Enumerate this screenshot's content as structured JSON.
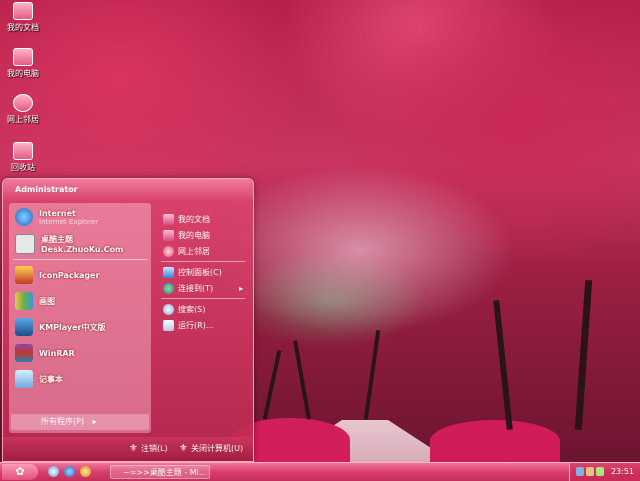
{
  "desktop_icons": [
    {
      "name": "mydocs",
      "label": "我的文档"
    },
    {
      "name": "mycomputer",
      "label": "我的电脑"
    },
    {
      "name": "network",
      "label": "网上邻居"
    },
    {
      "name": "recycle",
      "label": "回收站"
    }
  ],
  "start_menu": {
    "user": "Administrator",
    "pinned": [
      {
        "title": "Internet",
        "subtitle": "Internet Explorer"
      },
      {
        "title": "桌酷主题Desk.ZhuoKu.Com"
      }
    ],
    "programs": [
      {
        "title": "IconPackager"
      },
      {
        "title": "画图"
      },
      {
        "title": "KMPlayer中文版"
      },
      {
        "title": "WinRAR"
      },
      {
        "title": "记事本"
      }
    ],
    "all_programs": "所有程序(P)",
    "all_programs_arrow": "▸",
    "right": [
      {
        "label": "我的文档"
      },
      {
        "label": "我的电脑"
      },
      {
        "label": "网上邻居"
      },
      {
        "label": "控制面板(C)"
      },
      {
        "label": "连接到(T)",
        "arrow": "▸"
      },
      {
        "label": "搜索(S)"
      },
      {
        "label": "运行(R)..."
      }
    ],
    "logoff": "注销(L)",
    "shutdown": "关闭计算机(U)"
  },
  "taskbar": {
    "start_glyph": "✿",
    "task_label": "~=>>桌酷主题 - Mi...",
    "clock": "23:51"
  },
  "colors": {
    "accent": "#d83f6e",
    "highlight": "#f6a5bd"
  }
}
